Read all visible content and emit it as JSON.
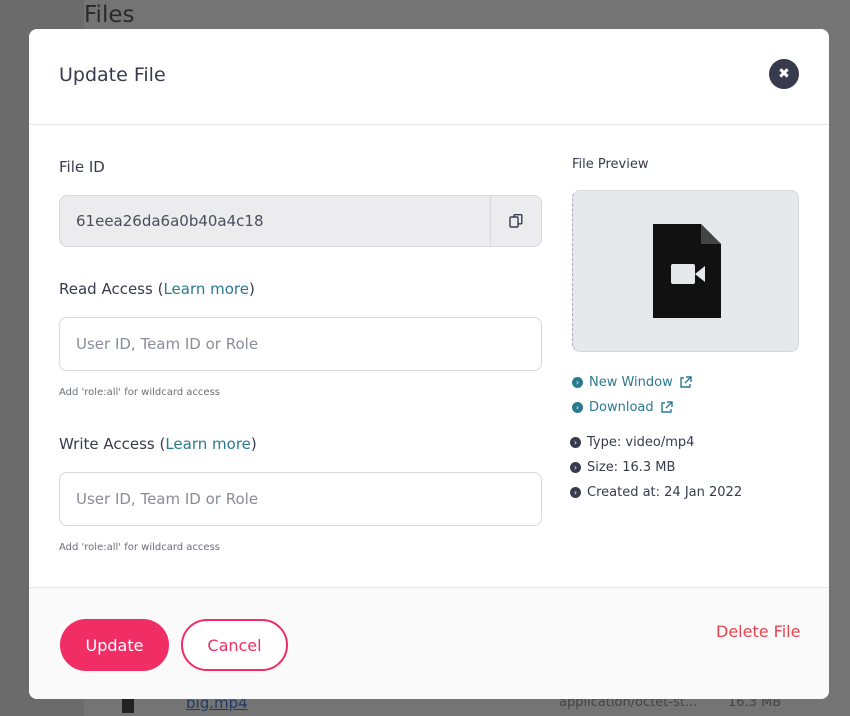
{
  "background": {
    "page_title": "Files",
    "file_row": {
      "name": "big.mp4",
      "type": "application/octet-st...",
      "size": "16.3 MB"
    }
  },
  "modal": {
    "title": "Update File",
    "file_id": {
      "label": "File ID",
      "value": "61eea26da6a0b40a4c18"
    },
    "read_access": {
      "label_prefix": "Read Access (",
      "learn_more": "Learn more",
      "label_suffix": ")",
      "placeholder": "User ID, Team ID or Role",
      "hint": "Add 'role:all' for wildcard access"
    },
    "write_access": {
      "label_prefix": "Write Access (",
      "learn_more": "Learn more",
      "label_suffix": ")",
      "placeholder": "User ID, Team ID or Role",
      "hint": "Add 'role:all' for wildcard access"
    },
    "preview": {
      "label": "File Preview",
      "links": {
        "new_window": "New Window",
        "download": "Download"
      },
      "meta": {
        "type": "Type: video/mp4",
        "size": "Size: 16.3 MB",
        "created": "Created at: 24 Jan 2022"
      }
    },
    "footer": {
      "update": "Update",
      "cancel": "Cancel",
      "delete": "Delete File"
    }
  },
  "colors": {
    "accent": "#f02e65",
    "link": "#2a7a8e",
    "danger": "#e8434f",
    "text": "#373b4d"
  }
}
